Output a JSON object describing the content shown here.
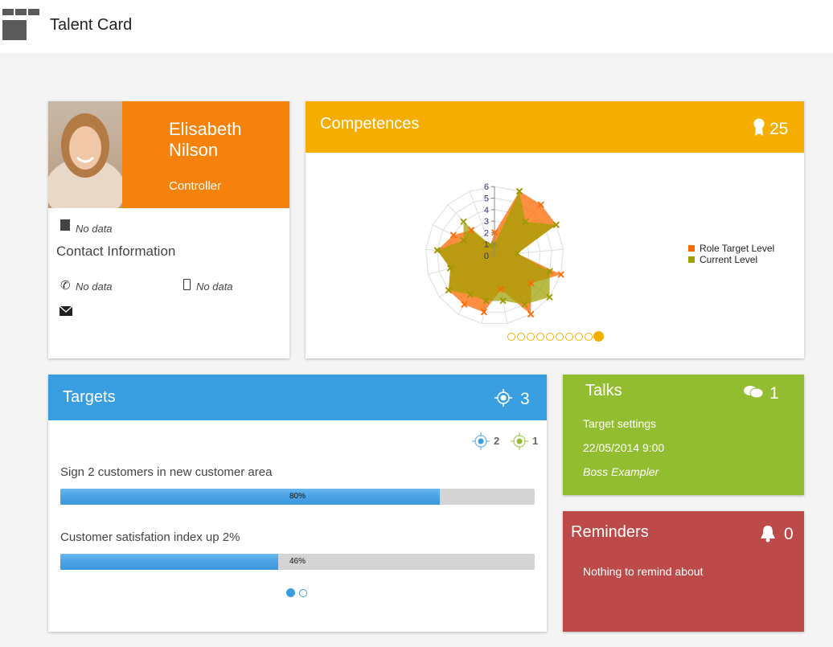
{
  "app": {
    "title": "Talent Card"
  },
  "profile": {
    "first_name": "Elisabeth",
    "last_name": "Nilson",
    "role": "Controller",
    "company": "No data",
    "contact_title": "Contact Information",
    "phone": "No data",
    "mobile": "No data"
  },
  "competences": {
    "title": "Competences",
    "count": "25",
    "icon": "award-icon",
    "page_count": 10,
    "active_page": 10
  },
  "chart_data": {
    "type": "radar",
    "radial_ticks": [
      "0",
      "1",
      "2",
      "3",
      "4",
      "5",
      "6"
    ],
    "rlim": [
      0,
      6
    ],
    "axes_count": 17,
    "legend_placement": "right",
    "series": [
      {
        "name": "Role Target Level",
        "color": "#ff6a00",
        "values": [
          2,
          6,
          6,
          6,
          2,
          6,
          4,
          6,
          3,
          5,
          5,
          5,
          4,
          5,
          4,
          3,
          1
        ]
      },
      {
        "name": "Current Level",
        "color": "#a0a000",
        "values": [
          1,
          6,
          4,
          6,
          2,
          5,
          6,
          5,
          4,
          4,
          4,
          5,
          4,
          5,
          3,
          4,
          1
        ]
      }
    ]
  },
  "targets": {
    "title": "Targets",
    "count": "3",
    "icon": "target-icon",
    "blue_count": "2",
    "green_count": "1",
    "items": [
      {
        "label": "Sign 2 customers in new customer area",
        "progress": 80,
        "progress_label": "80%"
      },
      {
        "label": "Customer satisfation index up 2%",
        "progress": 46,
        "progress_label": "46%"
      }
    ]
  },
  "talks": {
    "title": "Talks",
    "count": "1",
    "icon": "chat-icon",
    "subject": "Target settings",
    "datetime": "22/05/2014 9:00",
    "person": "Boss Exampler"
  },
  "reminders": {
    "title": "Reminders",
    "count": "0",
    "icon": "bell-icon",
    "message": "Nothing to remind about"
  },
  "colors": {
    "orange": "#f5820d",
    "yellow": "#f5ae00",
    "blue": "#399ee0",
    "green": "#93bd31",
    "red": "#bc4a48"
  }
}
